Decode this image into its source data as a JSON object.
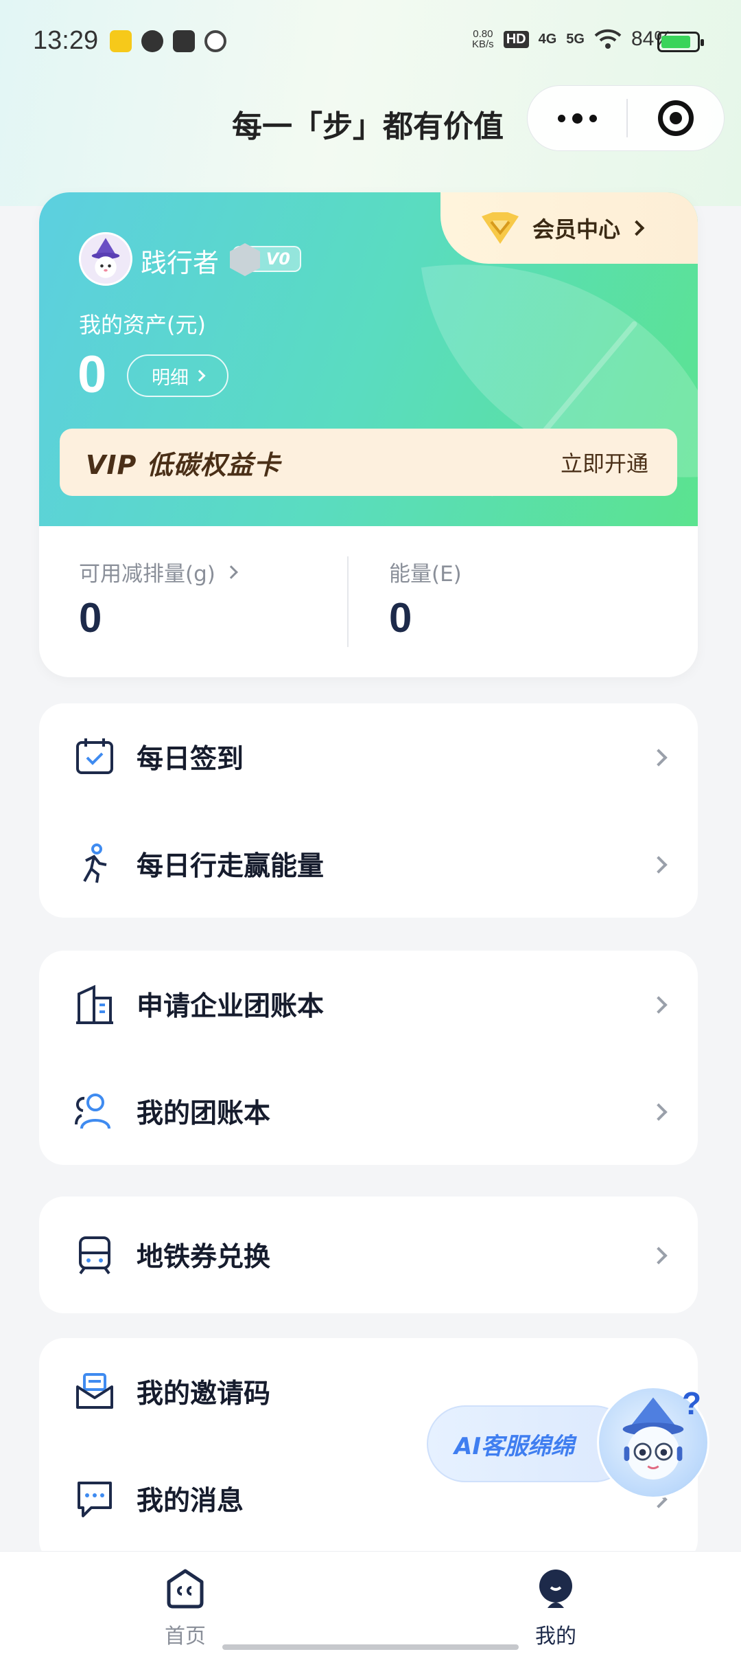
{
  "status_bar": {
    "time": "13:29",
    "net_speed_value": "0.80",
    "net_speed_unit": "KB/s",
    "hd_label": "HD",
    "net_4g": "4G",
    "net_5g": "5G",
    "battery_percent": "84%",
    "battery_level": 0.84
  },
  "header": {
    "title": "每一「步」都有价值"
  },
  "profile": {
    "name": "践行者",
    "level": "V0",
    "member_center": "会员中心",
    "asset_label": "我的资产(元)",
    "asset_value": "0",
    "detail_button": "明细"
  },
  "vip_card": {
    "title": "VIP 低碳权益卡",
    "action": "立即开通"
  },
  "stats": {
    "reduction_label": "可用减排量(g)",
    "reduction_value": "0",
    "energy_label": "能量(E)",
    "energy_value": "0"
  },
  "menu_groups": [
    {
      "items": [
        {
          "label": "每日签到",
          "icon": "calendar-check-icon"
        },
        {
          "label": "每日行走赢能量",
          "icon": "walking-icon"
        }
      ]
    },
    {
      "items": [
        {
          "label": "申请企业团账本",
          "icon": "building-icon"
        },
        {
          "label": "我的团账本",
          "icon": "group-icon"
        }
      ]
    },
    {
      "items": [
        {
          "label": "地铁券兑换",
          "icon": "subway-icon"
        }
      ]
    },
    {
      "items": [
        {
          "label": "我的邀请码",
          "icon": "invite-envelope-icon"
        },
        {
          "label": "我的消息",
          "icon": "message-icon"
        }
      ]
    }
  ],
  "ai_assistant": {
    "label": "AI客服绵绵",
    "mark": "?"
  },
  "tabbar": {
    "home": "首页",
    "mine": "我的",
    "active_color": "#1d2a4a",
    "inactive_color": "#8a8f99"
  },
  "colors": {
    "card_gradient_start": "#5ccfe0",
    "card_gradient_end": "#5be38f",
    "vip_text": "#4a2f17",
    "ai_text": "#3f7ef0"
  }
}
